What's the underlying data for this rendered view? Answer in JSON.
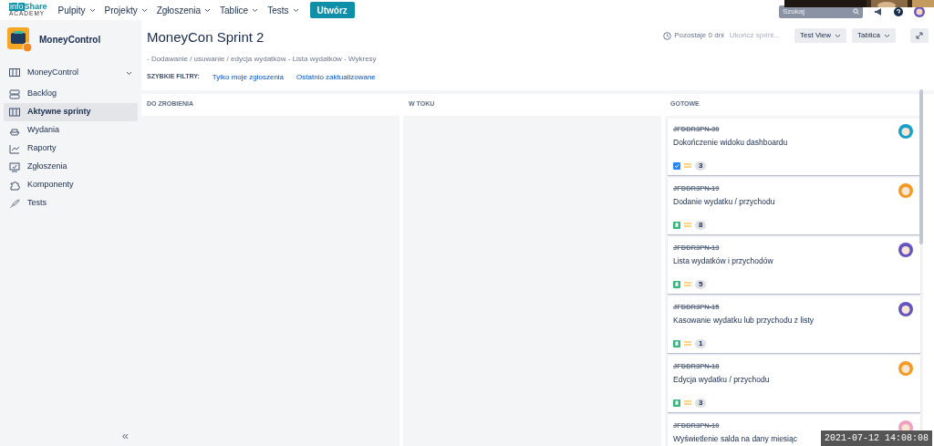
{
  "top_nav": {
    "logo": {
      "word_1": "info",
      "word_2": "Share",
      "word_3": "ACADEMY"
    },
    "menus": [
      {
        "label": "Pulpity"
      },
      {
        "label": "Projekty"
      },
      {
        "label": "Zgłoszenia"
      },
      {
        "label": "Tablice"
      },
      {
        "label": "Tests"
      }
    ],
    "create_button": "Utwórz",
    "search": {
      "placeholder": "Szukaj"
    }
  },
  "sidebar": {
    "project": "MoneyControl",
    "board_switcher": "MoneyControl",
    "items": [
      {
        "label": "Backlog",
        "selected": false
      },
      {
        "label": "Aktywne sprinty",
        "selected": true
      },
      {
        "label": "Wydania",
        "selected": false
      },
      {
        "label": "Raporty",
        "selected": false
      },
      {
        "label": "Zgłoszenia",
        "selected": false
      },
      {
        "label": "Komponenty",
        "selected": false
      },
      {
        "label": "Tests",
        "selected": false
      }
    ],
    "collapse": "«"
  },
  "header": {
    "title": "MoneyCon Sprint 2",
    "epics": "- Dodawanie / usuwanie / edycja wydatków - Lista wydatków - Wykresy",
    "remaining": "Pozostaje 0 dni",
    "complete_sprint": {
      "label": "Ukończ sprint...",
      "disabled": true
    },
    "view_button": "Test View",
    "board_button": "Tablica"
  },
  "quick_filters": {
    "label": "SZYBKIE FILTRY:",
    "filters": [
      "Tylko moje zgłoszenia",
      "Ostatnio zaktualizowane"
    ]
  },
  "columns": [
    {
      "title": "DO ZROBIENIA"
    },
    {
      "title": "W TOKU"
    },
    {
      "title": "GOTOWE",
      "cards": [
        {
          "key": "JFDDR3PN-30",
          "summary": "Dokończenie widoku dashboardu",
          "kind": "task",
          "estimate": "3"
        },
        {
          "key": "JFDDR3PN-19",
          "summary": "Dodanie wydatku / przychodu",
          "kind": "story",
          "estimate": "8"
        },
        {
          "key": "JFDDR3PN-13",
          "summary": "Lista wydatków i przychodów",
          "kind": "story",
          "estimate": "5"
        },
        {
          "key": "JFDDR3PN-15",
          "summary": "Kasowanie wydatku lub przychodu z listy",
          "kind": "story",
          "estimate": "1"
        },
        {
          "key": "JFDDR3PN-18",
          "summary": "Edycja wydatku / przychodu",
          "kind": "story",
          "estimate": "3"
        },
        {
          "key": "JFDDR3PN-10",
          "summary": "Wyświetlenie salda na dany miesiąc"
        }
      ]
    }
  ],
  "video_timestamp": "2021-07-12 14:08:08"
}
